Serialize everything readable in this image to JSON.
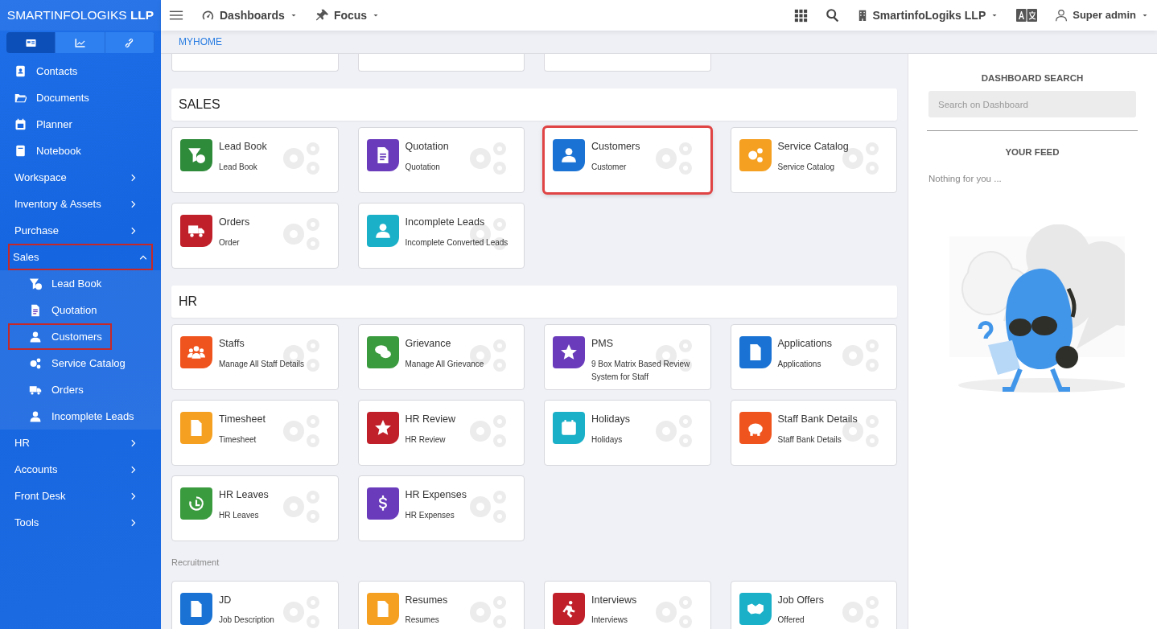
{
  "sidebar": {
    "brand": "SMARTINFOLOGIKS **LLP**",
    "tabs": [
      {
        "selected": true
      },
      {
        "selected": false
      },
      {
        "selected": false
      }
    ],
    "items": [
      {
        "label": "Contacts",
        "kind": "link",
        "highlighted": false
      },
      {
        "label": "Documents",
        "kind": "link",
        "highlighted": false
      },
      {
        "label": "Planner",
        "kind": "link",
        "highlighted": false
      },
      {
        "label": "Notebook",
        "kind": "link",
        "highlighted": false
      },
      {
        "label": "Workspace",
        "kind": "group",
        "expanded": false,
        "highlighted": false
      },
      {
        "label": "Inventory & Assets",
        "kind": "group",
        "expanded": false,
        "highlighted": false
      },
      {
        "label": "Purchase",
        "kind": "group",
        "expanded": false,
        "highlighted": false
      },
      {
        "label": "Sales",
        "kind": "group",
        "expanded": true,
        "highlighted": true,
        "children": [
          {
            "label": "Lead Book",
            "highlighted": false
          },
          {
            "label": "Quotation",
            "highlighted": false
          },
          {
            "label": "Customers",
            "highlighted": true
          },
          {
            "label": "Service Catalog",
            "highlighted": false
          },
          {
            "label": "Orders",
            "highlighted": false
          },
          {
            "label": "Incomplete Leads",
            "highlighted": false
          }
        ]
      },
      {
        "label": "HR",
        "kind": "group",
        "expanded": false,
        "highlighted": false
      },
      {
        "label": "Accounts",
        "kind": "group",
        "expanded": false,
        "highlighted": false
      },
      {
        "label": "Front Desk",
        "kind": "group",
        "expanded": false,
        "highlighted": false
      },
      {
        "label": "Tools",
        "kind": "group",
        "expanded": false,
        "highlighted": false
      }
    ]
  },
  "topbar": {
    "left": [
      {
        "label": "Dashboards"
      },
      {
        "label": "Focus"
      }
    ],
    "company": "SmartinfoLogiks LLP",
    "user": "Super admin"
  },
  "breadcrumb": "MYHOME",
  "sections": [
    {
      "title": "SALES",
      "kind": "header",
      "cards": [
        {
          "title": "Lead Book",
          "subtitle": "Lead Book",
          "color": "#2e8b3a",
          "highlighted": false
        },
        {
          "title": "Quotation",
          "subtitle": "Quotation",
          "color": "#6a3cbc",
          "highlighted": false
        },
        {
          "title": "Customers",
          "subtitle": "Customer",
          "color": "#1a73d4",
          "highlighted": true
        },
        {
          "title": "Service Catalog",
          "subtitle": "Service Catalog",
          "color": "#f5a020",
          "highlighted": false
        },
        {
          "title": "Orders",
          "subtitle": "Order",
          "color": "#c0202a",
          "highlighted": false
        },
        {
          "title": "Incomplete Leads",
          "subtitle": "Incomplete Converted Leads",
          "color": "#1ab0c8",
          "highlighted": false
        }
      ]
    },
    {
      "title": "HR",
      "kind": "header",
      "cards": [
        {
          "title": "Staffs",
          "subtitle": "Manage All Staff Details",
          "color": "#f0541e",
          "highlighted": false
        },
        {
          "title": "Grievance",
          "subtitle": "Manage All Grievance",
          "color": "#3a9a3e",
          "highlighted": false
        },
        {
          "title": "PMS",
          "subtitle": "9 Box Matrix Based Review System for Staff",
          "color": "#6a3cbc",
          "highlighted": false
        },
        {
          "title": "Applications",
          "subtitle": "Applications",
          "color": "#1a73d4",
          "highlighted": false
        },
        {
          "title": "Timesheet",
          "subtitle": "Timesheet",
          "color": "#f5a020",
          "highlighted": false
        },
        {
          "title": "HR Review",
          "subtitle": "HR Review",
          "color": "#c0202a",
          "highlighted": false
        },
        {
          "title": "Holidays",
          "subtitle": "Holidays",
          "color": "#1ab0c8",
          "highlighted": false
        },
        {
          "title": "Staff Bank Details",
          "subtitle": "Staff Bank Details",
          "color": "#f0541e",
          "highlighted": false
        },
        {
          "title": "HR Leaves",
          "subtitle": "HR Leaves",
          "color": "#3a9a3e",
          "highlighted": false
        },
        {
          "title": "HR Expenses",
          "subtitle": "HR Expenses",
          "color": "#6a3cbc",
          "highlighted": false
        }
      ]
    },
    {
      "title": "Recruitment",
      "kind": "label",
      "cards": [
        {
          "title": "JD",
          "subtitle": "Job Description",
          "color": "#1a73d4",
          "highlighted": false
        },
        {
          "title": "Resumes",
          "subtitle": "Resumes",
          "color": "#f5a020",
          "highlighted": false
        },
        {
          "title": "Interviews",
          "subtitle": "Interviews",
          "color": "#c0202a",
          "highlighted": false
        },
        {
          "title": "Job Offers",
          "subtitle": "Offered",
          "color": "#1ab0c8",
          "highlighted": false
        }
      ]
    }
  ],
  "panel": {
    "search_title": "DASHBOARD SEARCH",
    "search": {
      "placeholder": "Search on Dashboard"
    },
    "feed_title": "YOUR FEED",
    "feed_text": "Nothing for you ..."
  }
}
